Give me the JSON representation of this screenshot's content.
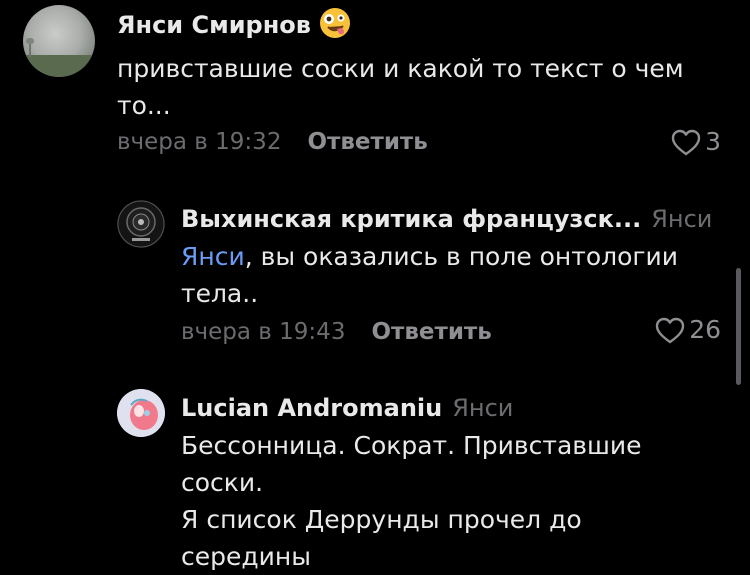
{
  "comments": [
    {
      "author": "Янси Смирнов",
      "emoji": "crazy-face-emoji",
      "text": "привставшие соски и какой то текст о чем то...",
      "time": "вчера в 19:32",
      "reply_label": "Ответить",
      "likes": "3"
    },
    {
      "author": "Выхинская критика французск...",
      "reply_to": "Янси",
      "mention": "Янси",
      "text": ", вы оказались в поле онтологии тела..",
      "time": "вчера в 19:43",
      "reply_label": "Ответить",
      "likes": "26"
    },
    {
      "author": "Lucian Andromaniu",
      "reply_to": "Янси",
      "text_lines": [
        "Бессонница. Сократ. Привставшие соски.",
        "Я список Деррунды прочел до середины"
      ]
    }
  ],
  "colors": {
    "background": "#000000",
    "text": "#e9e9ea",
    "secondary": "#6c6c70",
    "mention": "#6b9cf6"
  }
}
